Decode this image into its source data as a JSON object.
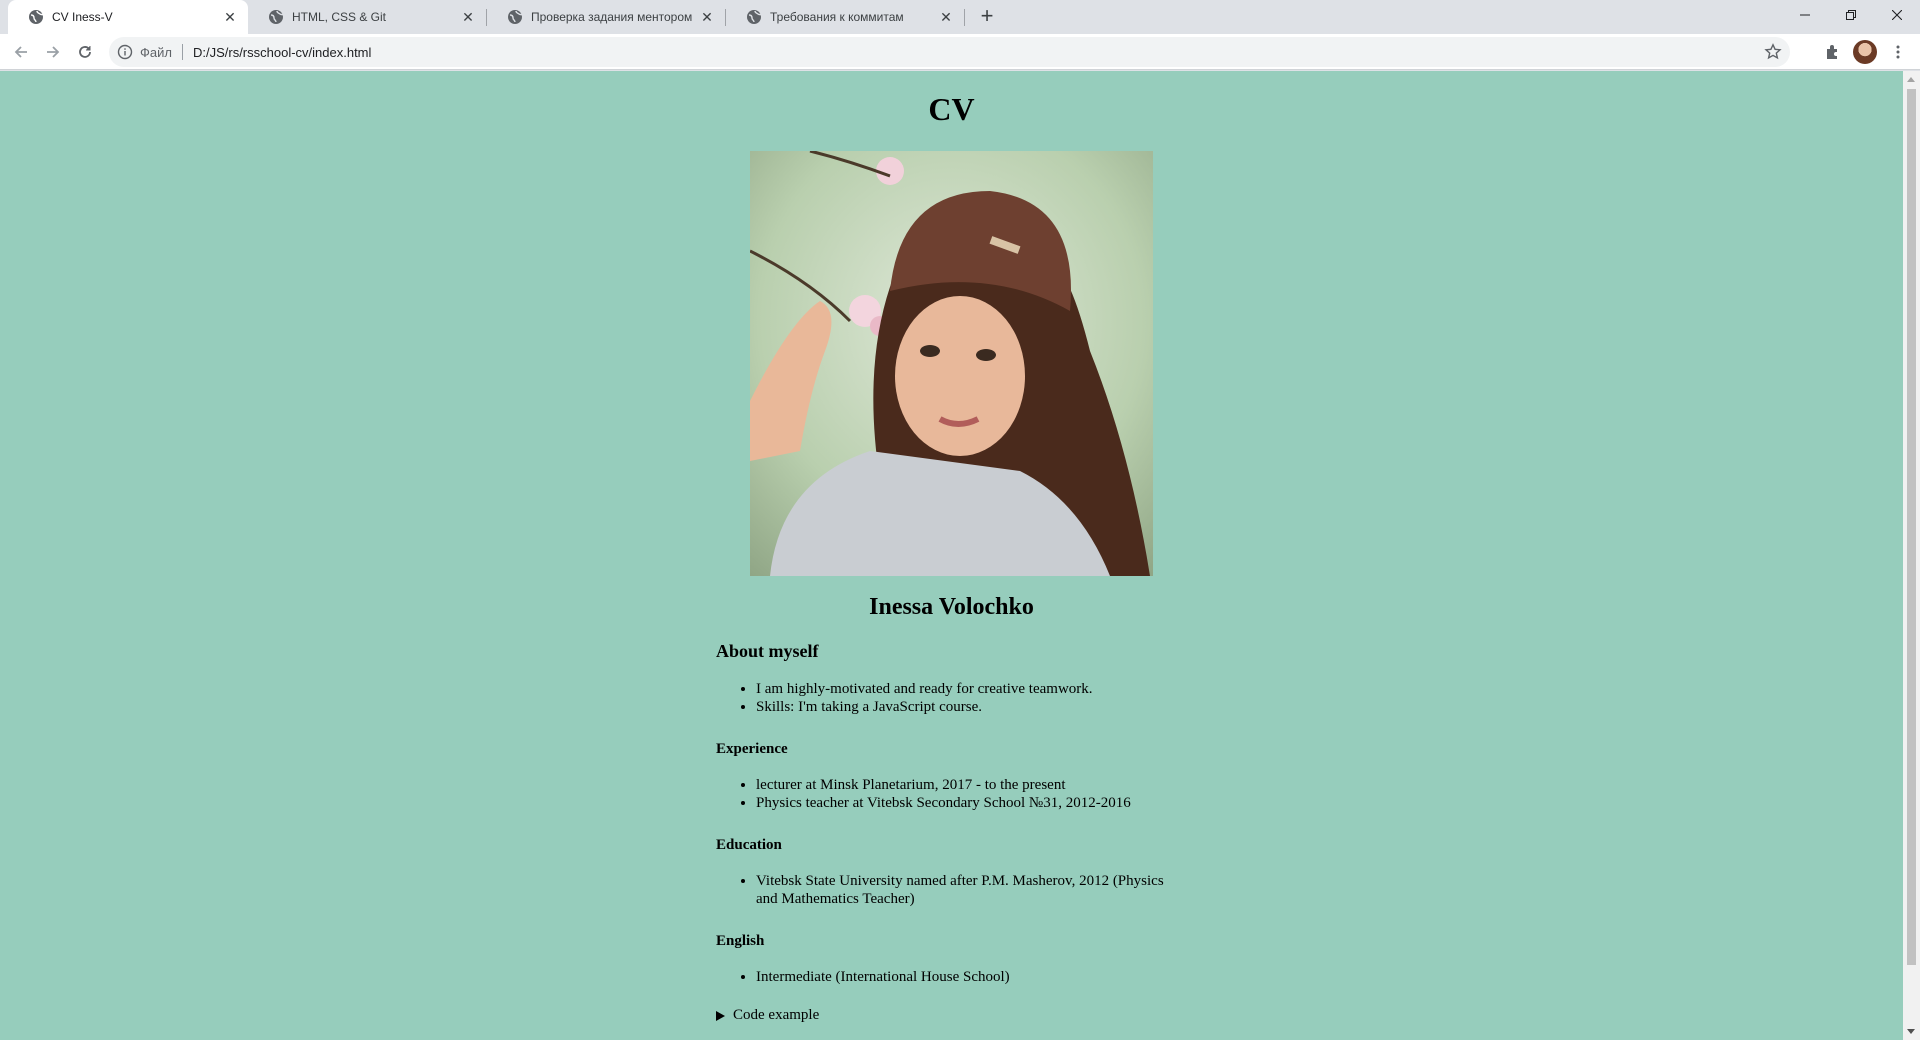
{
  "browser": {
    "tabs": [
      {
        "title": "CV Iness-V",
        "active": true
      },
      {
        "title": "HTML, CSS & Git",
        "active": false
      },
      {
        "title": "Проверка задания ментором",
        "active": false
      },
      {
        "title": "Требования к коммитам",
        "active": false
      }
    ],
    "address": {
      "scheme": "Файл",
      "url": "D:/JS/rs/rsschool-cv/index.html"
    }
  },
  "page": {
    "heading": "CV",
    "name": "Inessa Volochko",
    "about": {
      "title": "About myself",
      "items": [
        "I am highly-motivated and ready for creative teamwork.",
        "Skills: I'm taking a JavaScript course."
      ]
    },
    "experience": {
      "title": "Experience",
      "items": [
        "lecturer at Minsk Planetarium, 2017 - to the present",
        "Physics teacher at Vitebsk Secondary School №31, 2012-2016"
      ]
    },
    "education": {
      "title": "Education",
      "items": [
        "Vitebsk State University named after P.M. Masherov, 2012 (Physics and Mathematics Teacher)"
      ]
    },
    "english": {
      "title": "English",
      "items": [
        "Intermediate (International House School)"
      ]
    },
    "code_example": "Code example"
  },
  "colors": {
    "page_background": "#96cdbc",
    "tabstrip": "#dee1e6"
  }
}
